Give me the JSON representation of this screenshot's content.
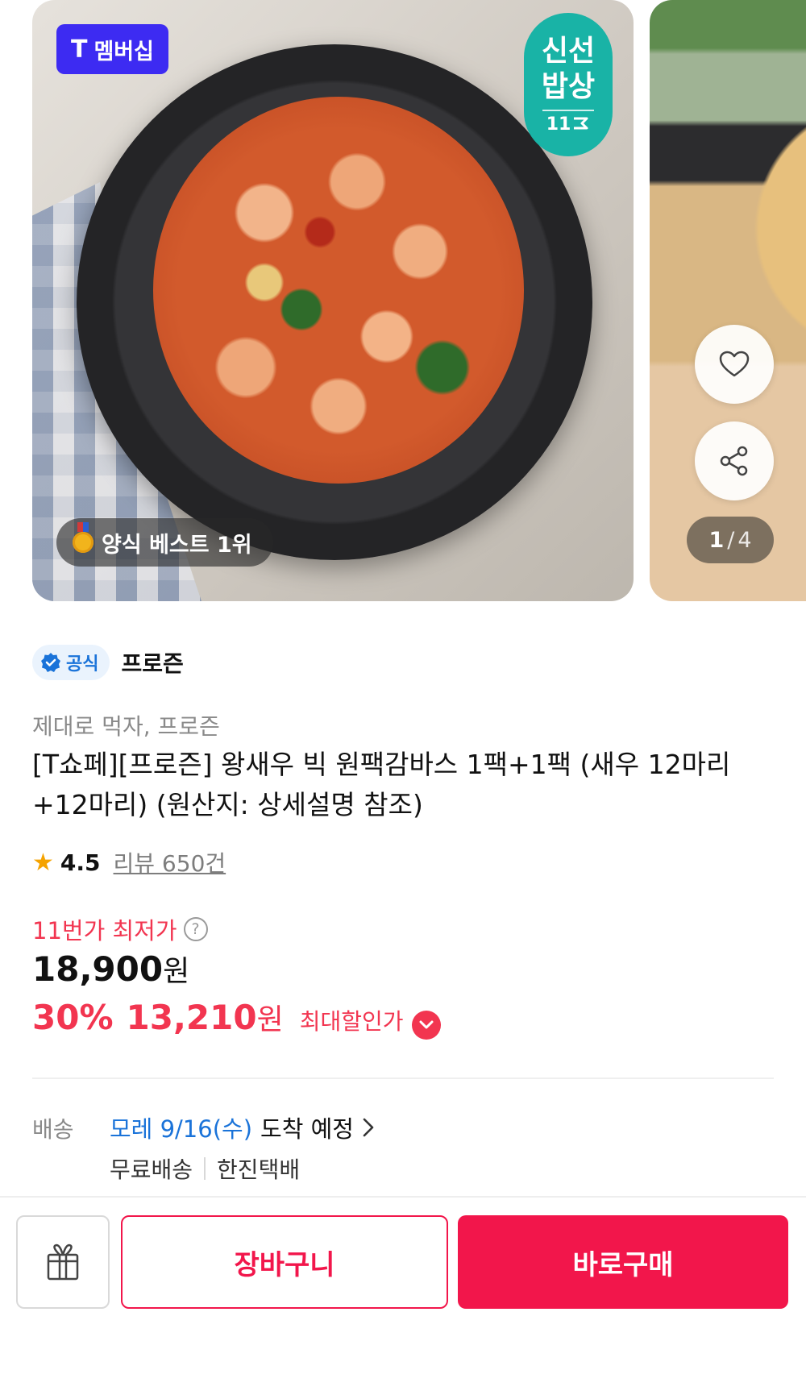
{
  "colors": {
    "accent": "#f2164b",
    "price_red": "#f23550",
    "link_blue": "#1a73d9",
    "membership": "#3d2bf2",
    "fresh_teal": "#19b3a6"
  },
  "gallery": {
    "membership_badge": {
      "mark": "T",
      "label": "멤버십"
    },
    "fresh_badge": {
      "line1": "신선",
      "line2": "밥상",
      "mark": "11"
    },
    "best_badge": {
      "icon": "medal-icon",
      "label": "양식 베스트 1위"
    },
    "wishlist_icon": "heart-icon",
    "share_icon": "share-icon",
    "pager": {
      "current": "1",
      "separator": "/",
      "total": "4"
    }
  },
  "product": {
    "official_label": "공식",
    "seller": "프로즌",
    "tagline": "제대로 먹자, 프로즌",
    "title": "[T쇼페][프로즌] 왕새우 빅 원팩감바스 1팩+1팩 (새우 12마리+12마리) (원산지: 상세설명 참조)",
    "rating": "4.5",
    "reviews": "리뷰 650건"
  },
  "price": {
    "lowest_label": "11번가 최저가",
    "original": "18,900",
    "unit": "원",
    "discount_rate": "30%",
    "sale_price": "13,210",
    "max_discount_label": "최대할인가"
  },
  "shipping": {
    "label": "배송",
    "date": "모레 9/16(수)",
    "arrival": "도착 예정",
    "fee": "무료배송",
    "carrier": "한진택배"
  },
  "actions": {
    "gift_icon": "gift-icon",
    "cart_label": "장바구니",
    "buy_label": "바로구매"
  }
}
